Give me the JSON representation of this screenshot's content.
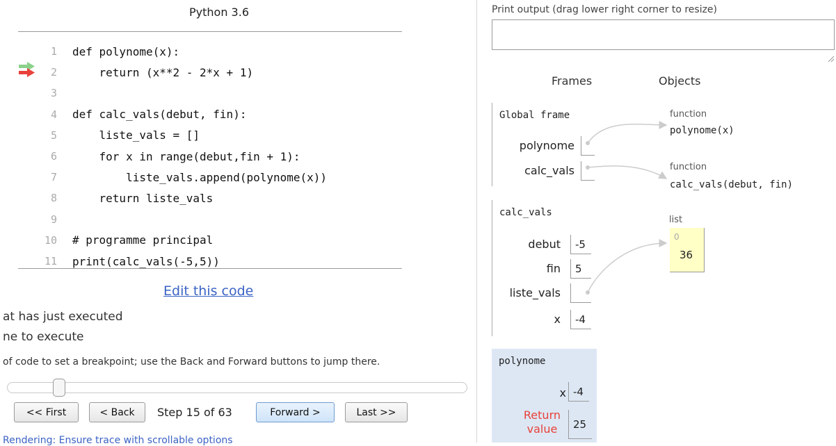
{
  "editor": {
    "language": "Python 3.6",
    "lines": [
      {
        "num": "1",
        "text": "def polynome(x):"
      },
      {
        "num": "2",
        "text": "    return (x**2 - 2*x + 1)"
      },
      {
        "num": "3",
        "text": ""
      },
      {
        "num": "4",
        "text": "def calc_vals(debut, fin):"
      },
      {
        "num": "5",
        "text": "    liste_vals = []"
      },
      {
        "num": "6",
        "text": "    for x in range(debut,fin + 1):"
      },
      {
        "num": "7",
        "text": "        liste_vals.append(polynome(x))"
      },
      {
        "num": "8",
        "text": "    return liste_vals"
      },
      {
        "num": "9",
        "text": ""
      },
      {
        "num": "10",
        "text": "# programme principal"
      },
      {
        "num": "11",
        "text": "print(calc_vals(-5,5))"
      }
    ],
    "edit_link": "Edit this code",
    "legend_just_executed": "at has just executed",
    "legend_next": "ne to execute",
    "hint": " of code to set a breakpoint; use the Back and Forward buttons to jump there.",
    "bottom_link": "Rendering: Ensure trace with scrollable options",
    "arrow_colors": {
      "just_executed": "#8bd18b",
      "next": "#e8413a"
    }
  },
  "navigation": {
    "first": "<< First",
    "back": "< Back",
    "step": "Step 15 of 63",
    "forward": "Forward >",
    "last": "Last >>",
    "progress": 0.23
  },
  "output": {
    "label": "Print output (drag lower right corner to resize)",
    "value": ""
  },
  "viz": {
    "frames_header": "Frames",
    "objects_header": "Objects",
    "global_frame": {
      "title": "Global frame",
      "vars": [
        {
          "name": "polynome"
        },
        {
          "name": "calc_vals"
        }
      ]
    },
    "calc_frame": {
      "title": "calc_vals",
      "vars": [
        {
          "name": "debut",
          "value": "-5"
        },
        {
          "name": "fin",
          "value": "5"
        },
        {
          "name": "liste_vals",
          "value": ""
        },
        {
          "name": "x",
          "value": "-4"
        }
      ]
    },
    "poly_frame": {
      "title": "polynome",
      "x_name": "x",
      "x_value": "-4",
      "return_label_1": "Return",
      "return_label_2": "value",
      "return_value": "25"
    },
    "objects": {
      "func1_type": "function",
      "func1_sig": "polynome(x)",
      "func2_type": "function",
      "func2_sig": "calc_vals(debut, fin)",
      "list_type": "list",
      "list_index": "0",
      "list_value": "36"
    },
    "colors": {
      "active_frame": "#dde7f4",
      "list_bg": "#ffffc6",
      "return_label": "#e8413a"
    }
  }
}
